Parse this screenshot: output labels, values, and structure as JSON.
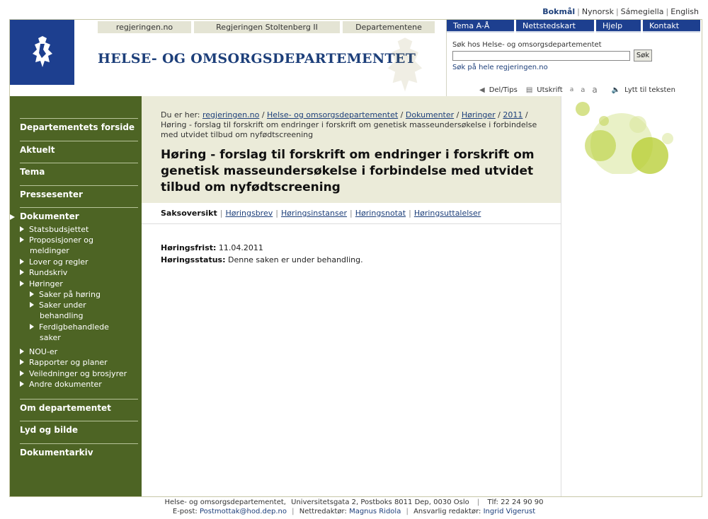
{
  "lang": {
    "bokmal": "Bokmål",
    "nynorsk": "Nynorsk",
    "samegiella": "Sámegiella",
    "english": "English"
  },
  "header": {
    "tabs": [
      "regjeringen.no",
      "Regjeringen Stoltenberg II",
      "Departementene"
    ],
    "title": "HELSE- OG OMSORGSDEPARTEMENTET",
    "blue_tabs": [
      "Tema A-Å",
      "Nettstedskart",
      "Hjelp",
      "Kontakt"
    ],
    "search_label": "Søk hos Helse- og omsorgsdepartementet",
    "search_value": "",
    "search_button": "Søk",
    "search_all": "Søk på hele regjeringen.no",
    "tools": {
      "share": "Del/Tips",
      "print": "Utskrift",
      "sizes": [
        "a",
        "a",
        "a"
      ],
      "listen": "Lytt til teksten"
    }
  },
  "leftnav": {
    "sections": [
      "Departementets forside",
      "Aktuelt",
      "Tema",
      "Pressesenter",
      "Dokumenter",
      "Om departementet",
      "Lyd og bilde",
      "Dokumentarkiv"
    ],
    "dokumenter_items": [
      "Statsbudsjettet",
      "Proposisjoner og",
      "meldinger",
      "Lover og regler",
      "Rundskriv",
      "Høringer",
      "NOU-er",
      "Rapporter og planer",
      "Veiledninger og brosjyrer",
      "Andre dokumenter"
    ],
    "horinger_items": [
      "Saker på høring",
      "Saker under",
      "behandling",
      "Ferdigbehandlede",
      "saker"
    ]
  },
  "breadcrumb": {
    "prefix": "Du er her:",
    "links": [
      "regjeringen.no",
      "Helse- og omsorgsdepartementet",
      "Dokumenter",
      "Høringer",
      "2011"
    ],
    "current": "Høring - forslag til forskrift om endringer i forskrift om genetisk masseundersøkelse i forbindelse med utvidet tilbud om nyfødtscreening"
  },
  "page": {
    "title": "Høring - forslag til forskrift om endringer i forskrift om genetisk masseundersøkelse i forbindelse med utvidet tilbud om nyfødtscreening",
    "subnav_current": "Saksoversikt",
    "subnav_links": [
      "Høringsbrev",
      "Høringsinstanser",
      "Høringsnotat",
      "Høringsuttalelser"
    ],
    "frist_label": "Høringsfrist:",
    "frist_value": "11.04.2011",
    "status_label": "Høringsstatus:",
    "status_value": "Denne saken er under behandling."
  },
  "footer": {
    "line1_dept": "Helse- og omsorgsdepartementet,",
    "line1_address": "Universitetsgata 2, Postboks 8011 Dep,  0030 Oslo",
    "line1_phone": "Tlf: 22 24 90 90",
    "email_label": "E-post:",
    "email": "Postmottak@hod.dep.no",
    "editor_label": "Nettredaktør:",
    "editor": "Magnus Ridola",
    "responsible_label": "Ansvarlig redaktør:",
    "responsible": "Ingrid Vigerust"
  },
  "colors": {
    "brand_blue": "#1d3f8f",
    "nav_green": "#4d6424",
    "head_beige": "#ebebd9",
    "accent_lime": "#b5cc2e"
  }
}
